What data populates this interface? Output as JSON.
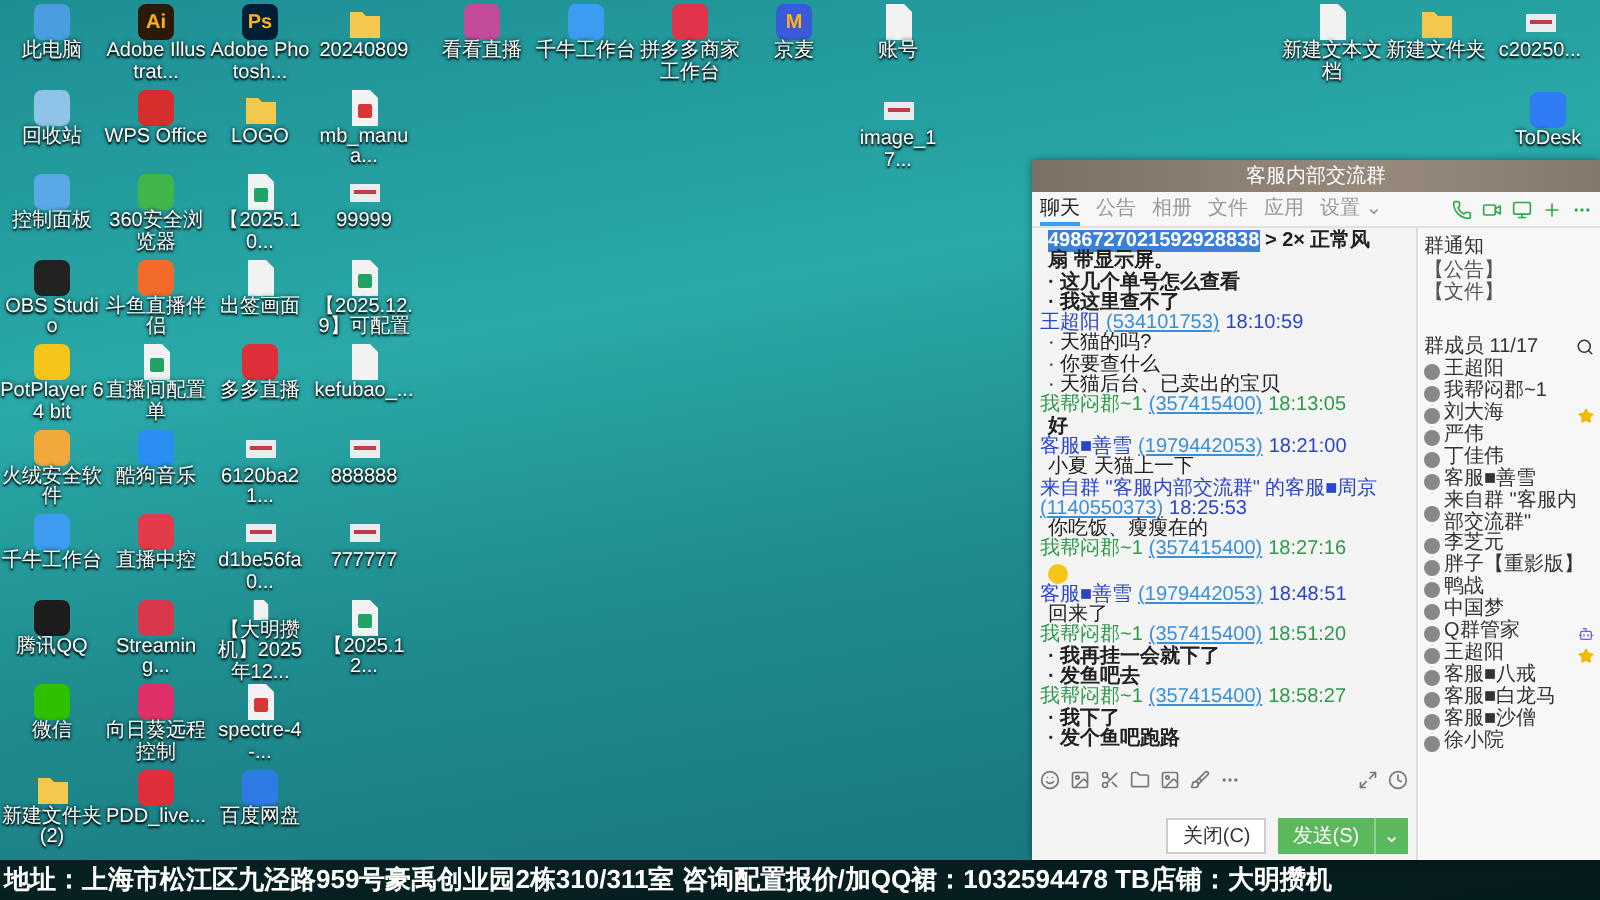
{
  "desktop": {
    "left_icons": [
      [
        {
          "label": "此电脑",
          "kind": "app",
          "color": "#4a9ee0"
        },
        {
          "label": "Adobe Illustrat...",
          "kind": "app",
          "color": "#2b1a05",
          "glyph": "Ai"
        },
        {
          "label": "Adobe Photosh...",
          "kind": "app",
          "color": "#001e36",
          "glyph": "Ps"
        },
        {
          "label": "20240809",
          "kind": "folder"
        }
      ],
      [
        {
          "label": "回收站",
          "kind": "app",
          "color": "#8fc4e8"
        },
        {
          "label": "WPS Office",
          "kind": "app",
          "color": "#d62d2d"
        },
        {
          "label": "LOGO",
          "kind": "folder"
        },
        {
          "label": "mb_manua...",
          "kind": "pdf"
        }
      ],
      [
        {
          "label": "控制面板",
          "kind": "app",
          "color": "#5aa9e6"
        },
        {
          "label": "360安全浏览器",
          "kind": "app",
          "color": "#3fb54a"
        },
        {
          "label": "【2025.10...",
          "kind": "sheet"
        },
        {
          "label": "99999",
          "kind": "image"
        }
      ],
      [
        {
          "label": "OBS Studio",
          "kind": "app",
          "color": "#222222"
        },
        {
          "label": "斗鱼直播伴侣",
          "kind": "app",
          "color": "#f26b2a"
        },
        {
          "label": "出签画面",
          "kind": "file"
        },
        {
          "label": "【2025.12.9】可配置",
          "kind": "sheet"
        }
      ],
      [
        {
          "label": "PotPlayer 64 bit",
          "kind": "app",
          "color": "#f5c518"
        },
        {
          "label": "直播间配置单",
          "kind": "sheet"
        },
        {
          "label": "多多直播",
          "kind": "app",
          "color": "#e02e3a"
        },
        {
          "label": "kefubao_...",
          "kind": "file"
        }
      ],
      [
        {
          "label": "火绒安全软件",
          "kind": "app",
          "color": "#f2a93b"
        },
        {
          "label": "酷狗音乐",
          "kind": "app",
          "color": "#2a8ef2"
        },
        {
          "label": "6120ba21...",
          "kind": "image"
        },
        {
          "label": "888888",
          "kind": "image"
        }
      ],
      [
        {
          "label": "千牛工作台",
          "kind": "app",
          "color": "#3b9cf0"
        },
        {
          "label": "直播中控",
          "kind": "app",
          "color": "#e23b4a"
        },
        {
          "label": "d1be56fa0...",
          "kind": "image"
        },
        {
          "label": "777777",
          "kind": "image"
        }
      ],
      [
        {
          "label": "腾讯QQ",
          "kind": "app",
          "color": "#1c1c1c"
        },
        {
          "label": "Streaming...",
          "kind": "app",
          "color": "#d9374a"
        },
        {
          "label": "【大明攒机】2025年12...",
          "kind": "file"
        },
        {
          "label": "【2025.12...",
          "kind": "sheet"
        }
      ],
      [
        {
          "label": "微信",
          "kind": "app",
          "color": "#2dc100"
        },
        {
          "label": "向日葵远程控制",
          "kind": "app",
          "color": "#e0306a"
        },
        {
          "label": "spectre-4-...",
          "kind": "pdf"
        }
      ],
      [
        {
          "label": "新建文件夹(2)",
          "kind": "folder"
        },
        {
          "label": "PDD_live...",
          "kind": "app",
          "color": "#e02e3a"
        },
        {
          "label": "百度网盘",
          "kind": "app",
          "color": "#2e7be6"
        }
      ]
    ],
    "top_icons": [
      {
        "label": "看看直播",
        "kind": "app",
        "color": "#c44a9a"
      },
      {
        "label": "千牛工作台",
        "kind": "app",
        "color": "#3b9cf0"
      },
      {
        "label": "拼多多商家工作台",
        "kind": "app",
        "color": "#e0344a"
      },
      {
        "label": "京麦",
        "kind": "app",
        "color": "#3a5bd9",
        "glyph": "M"
      },
      {
        "label": "账号",
        "kind": "file"
      }
    ],
    "loose_icons": [
      {
        "label": "image_17...",
        "kind": "image"
      }
    ],
    "right_icons": [
      {
        "label": "新建文本文档",
        "kind": "file"
      },
      {
        "label": "新建文件夹",
        "kind": "folder"
      },
      {
        "label": "c20250...",
        "kind": "image"
      }
    ],
    "corner_icons": [
      {
        "label": "ToDesk",
        "kind": "app",
        "color": "#2f7cf6"
      }
    ]
  },
  "chat": {
    "title": "客服内部交流群",
    "tabs": [
      {
        "label": "聊天",
        "selected": true
      },
      {
        "label": "公告",
        "selected": false
      },
      {
        "label": "相册",
        "selected": false
      },
      {
        "label": "文件",
        "selected": false
      },
      {
        "label": "应用",
        "selected": false
      },
      {
        "label": "设置 ⌄",
        "selected": false
      }
    ],
    "messages": [
      {
        "kind": "text",
        "highlight": "4986727021592928838",
        "text": " > 2× 正常风扇 带显示屏。",
        "bold": true
      },
      {
        "kind": "text",
        "text": "· 这几个单号怎么查看",
        "bold": true
      },
      {
        "kind": "text",
        "text": "· 我这里查不了",
        "bold": true
      },
      {
        "kind": "header",
        "sender": "王超阳",
        "qq": "(534101753)",
        "time": "18:10:59",
        "self": false
      },
      {
        "kind": "text",
        "text": "· 天猫的吗?",
        "bold": false
      },
      {
        "kind": "text",
        "text": "· 你要查什么",
        "bold": false
      },
      {
        "kind": "text",
        "text": "· 天猫后台、已卖出的宝贝",
        "bold": false
      },
      {
        "kind": "header",
        "sender": "我帮闷郡~1",
        "qq": "(357415400)",
        "time": "18:13:05",
        "self": true
      },
      {
        "kind": "text",
        "text": "好",
        "bold": true
      },
      {
        "kind": "header",
        "sender": "客服■善雪",
        "qq": "(1979442053)",
        "time": "18:21:00",
        "self": false
      },
      {
        "kind": "text",
        "text": "小夏 天猫上一下",
        "bold": false
      },
      {
        "kind": "header",
        "sender": "来自群 \"客服内部交流群\" 的客服■周京",
        "qq": "(1140550373)",
        "time": "18:25:53",
        "self": false
      },
      {
        "kind": "text",
        "text": "你吃饭、瘦瘦在的",
        "bold": false
      },
      {
        "kind": "header",
        "sender": "我帮闷郡~1",
        "qq": "(357415400)",
        "time": "18:27:16",
        "self": true
      },
      {
        "kind": "emoji"
      },
      {
        "kind": "header",
        "sender": "客服■善雪",
        "qq": "(1979442053)",
        "time": "18:48:51",
        "self": false
      },
      {
        "kind": "text",
        "text": "回来了",
        "bold": false
      },
      {
        "kind": "header",
        "sender": "我帮闷郡~1",
        "qq": "(357415400)",
        "time": "18:51:20",
        "self": true
      },
      {
        "kind": "text",
        "text": "· 我再挂一会就下了",
        "bold": true
      },
      {
        "kind": "text",
        "text": "· 发鱼吧去",
        "bold": true
      },
      {
        "kind": "header",
        "sender": "我帮闷郡~1",
        "qq": "(357415400)",
        "time": "18:58:27",
        "self": true
      },
      {
        "kind": "text",
        "text": "· 我下了",
        "bold": true
      },
      {
        "kind": "text",
        "text": "· 发个鱼吧跑路",
        "bold": true
      }
    ],
    "buttons": {
      "close": "关闭(C)",
      "send": "发送(S)",
      "send_menu": "⌄"
    },
    "side": {
      "notice_title": "群通知",
      "notices": [
        "【公告】",
        "【文件】"
      ],
      "members_title": "群成员 11/17",
      "members": [
        {
          "name": "王超阳",
          "starred": false,
          "bot": false
        },
        {
          "name": "我帮闷郡~1",
          "starred": false,
          "bot": false
        },
        {
          "name": "刘大海",
          "starred": true,
          "bot": false
        },
        {
          "name": "严伟",
          "starred": false,
          "bot": false
        },
        {
          "name": "丁佳伟",
          "starred": false,
          "bot": false
        },
        {
          "name": "客服■善雪",
          "starred": false,
          "bot": false
        },
        {
          "name": "来自群 \"客服内部交流群\"",
          "starred": false,
          "bot": false
        },
        {
          "name": "李芝元",
          "starred": false,
          "bot": false
        },
        {
          "name": "胖子【重影版】",
          "starred": false,
          "bot": false
        },
        {
          "name": "鸭战",
          "starred": false,
          "bot": false
        },
        {
          "name": "中国梦",
          "starred": false,
          "bot": false
        },
        {
          "name": "Q群管家",
          "starred": false,
          "bot": true
        },
        {
          "name": "王超阳",
          "starred": true,
          "bot": false
        },
        {
          "name": "客服■八戒",
          "starred": false,
          "bot": false
        },
        {
          "name": "客服■白龙马",
          "starred": false,
          "bot": false
        },
        {
          "name": "客服■沙僧",
          "starred": false,
          "bot": false
        },
        {
          "name": "徐小院",
          "starred": false,
          "bot": false
        }
      ]
    }
  },
  "banner": {
    "text": "地址：上海市松江区九泾路959号豪禹创业园2栋310/311室  咨询配置报价/加QQ裙：1032594478  TB店铺：大明攒机"
  }
}
